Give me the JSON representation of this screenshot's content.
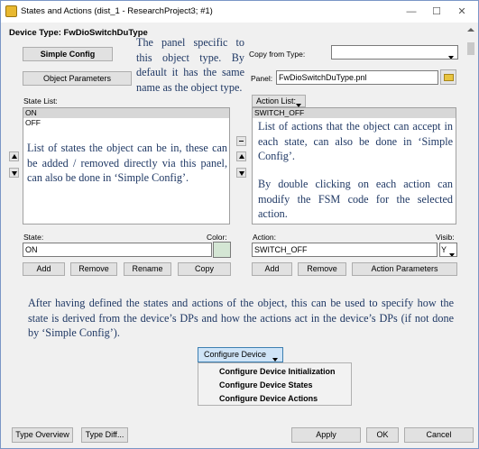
{
  "window": {
    "title": "States and Actions (dist_1 - ResearchProject3; #1)",
    "minimize": "—",
    "maximize": "☐",
    "close": "✕"
  },
  "device_type": {
    "label": "Device Type: FwDioSwitchDuType"
  },
  "buttons": {
    "simple_config": "Simple Config",
    "object_parameters": "Object Parameters",
    "action_parameters": "Action Parameters",
    "type_overview": "Type Overview",
    "type_diff": "Type Diff...",
    "apply": "Apply",
    "ok": "OK",
    "cancel": "Cancel"
  },
  "copy_from_type": {
    "label": "Copy from Type:",
    "value": ""
  },
  "panel": {
    "label": "Panel:",
    "value": "FwDioSwitchDuType.pnl"
  },
  "state_list": {
    "label": "State List:",
    "items": [
      "ON",
      "OFF"
    ],
    "selected_index": 0
  },
  "action_list": {
    "label": "Action List:",
    "items": [
      "SWITCH_OFF"
    ],
    "selected_index": 0
  },
  "state_editor": {
    "state_label": "State:",
    "color_label": "Color:",
    "value": "ON",
    "color": "#d4e6d4",
    "add": "Add",
    "remove": "Remove",
    "rename": "Rename",
    "copy": "Copy"
  },
  "action_editor": {
    "action_label": "Action:",
    "visib_label": "Visib:",
    "value": "SWITCH_OFF",
    "visib_value": "Y",
    "add": "Add",
    "remove": "Remove"
  },
  "annotations": {
    "panel_note": "The panel specific to this object type. By default it has the same name as the object type.",
    "states_note": "List of states the object can be in, these can be added / removed directly via this panel, can also be done in ‘Simple Config’.",
    "actions_note_1": "List of actions that the object can accept in each state, can also be done in ‘Simple Config’.",
    "actions_note_2": "By double clicking on each action can modify the FSM code for the selected action.",
    "configure_note": "After having defined the states and actions of the object, this can be used to specify how the state is derived from the device’s DPs and how the actions act in the device’s DPs (if not done by ‘Simple Config’)."
  },
  "configure_device": {
    "label": "Configure Device",
    "menu": [
      "Configure Device Initialization",
      "Configure Device States",
      "Configure Device Actions"
    ]
  },
  "colors": {
    "annotation_text": "#1f3864",
    "window_bg": "#f0f0f0",
    "selection": "#d7d7d7",
    "folder": "#e8c440"
  }
}
